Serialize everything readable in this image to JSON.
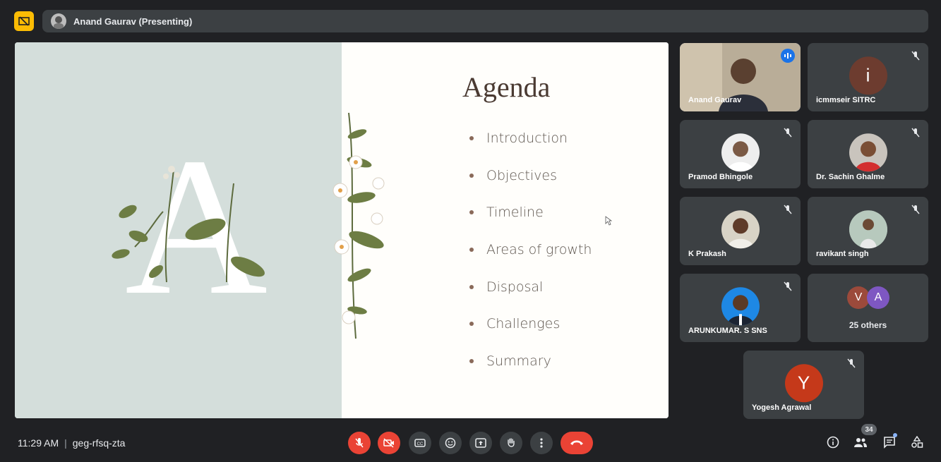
{
  "topbar": {
    "presenting_label": "Anand Gaurav (Presenting)"
  },
  "slide": {
    "title": "Agenda",
    "letter": "A",
    "items": [
      "Introduction",
      "Objectives",
      "Timeline",
      "Areas of growth",
      "Disposal",
      "Challenges",
      "Summary"
    ]
  },
  "participants": [
    {
      "name": "Anand Gaurav",
      "initial": "",
      "speaking": true
    },
    {
      "name": "icmmseir SITRC",
      "initial": "i",
      "color": "#6d3c2f"
    },
    {
      "name": "Pramod Bhingole",
      "initial": ""
    },
    {
      "name": "Dr. Sachin Ghalme",
      "initial": ""
    },
    {
      "name": "K Prakash",
      "initial": ""
    },
    {
      "name": "ravikant singh",
      "initial": ""
    },
    {
      "name": "ARUNKUMAR. S SNS",
      "initial": ""
    },
    {
      "name": "Yogesh Agrawal",
      "initial": "Y",
      "color": "#c5391a"
    }
  ],
  "others": {
    "label": "25 others",
    "initials": [
      "V",
      "A"
    ],
    "colors": [
      "#9c4a3b",
      "#7e57c2"
    ]
  },
  "footer": {
    "time": "11:29 AM",
    "separator": "|",
    "meeting_code": "geg-rfsq-zta",
    "participant_count": "34"
  },
  "colors": {
    "end_call": "#ea4335",
    "active_outline": "#8ab4f8",
    "tile": "#3c4043"
  }
}
